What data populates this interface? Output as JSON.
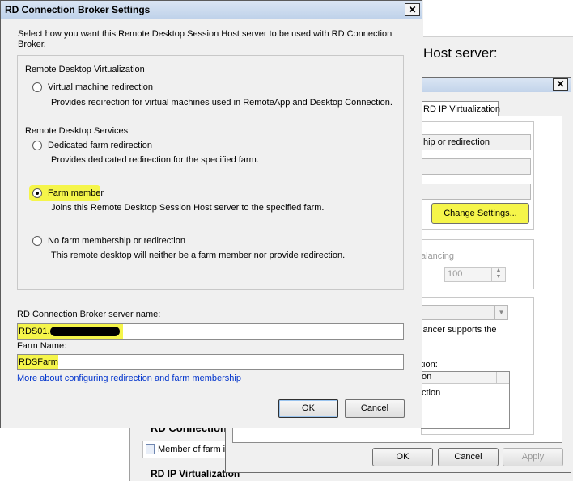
{
  "background_window": {
    "heading_fragment": "Host server:",
    "section_rd_connection": "RD Connection",
    "member_of_farm": "Member of farm in",
    "section_rd_ip_virtualization": "RD IP Virtualization"
  },
  "properties_window": {
    "tab_label": "RD IP Virtualization",
    "field_farm_membership": "hip or redirection",
    "change_settings_button": "Change Settings...",
    "load_balancing_label": "alancing",
    "relative_weight_value": "100",
    "load_balancer_supports": "lancer supports the",
    "list_caption": "tion:",
    "list_header": "on",
    "list_row": "ction",
    "ok_button": "OK",
    "cancel_button": "Cancel",
    "apply_button": "Apply",
    "close_glyph": "✕"
  },
  "dialog": {
    "title": "RD Connection Broker Settings",
    "close_glyph": "✕",
    "intro": "Select how you want this Remote Desktop Session Host server to be used with RD Connection Broker.",
    "section_virtualization": "Remote Desktop Virtualization",
    "option_vm_redirection": {
      "label": "Virtual machine redirection",
      "description": "Provides redirection for virtual machines used in RemoteApp and Desktop Connection.",
      "selected": false
    },
    "section_services": "Remote Desktop Services",
    "option_dedicated_farm": {
      "label": "Dedicated farm redirection",
      "description": "Provides dedicated redirection for the specified farm.",
      "selected": false
    },
    "option_farm_member": {
      "label": "Farm member",
      "description": "Joins this Remote Desktop Session Host server to the specified farm.",
      "selected": true
    },
    "option_no_farm": {
      "label": "No farm membership or redirection",
      "description": "This remote desktop will neither be a farm member nor provide redirection.",
      "selected": false
    },
    "server_name_label": "RD Connection Broker server name:",
    "server_name_value": "RDS01.",
    "farm_name_label": "Farm Name:",
    "farm_name_value": "RDSFarm",
    "help_link": "More about configuring redirection and farm membership",
    "ok_button": "OK",
    "cancel_button": "Cancel"
  },
  "colors": {
    "highlight": "#f5f54a",
    "link": "#0033cc",
    "dialog_background": "#f0f0f0"
  }
}
